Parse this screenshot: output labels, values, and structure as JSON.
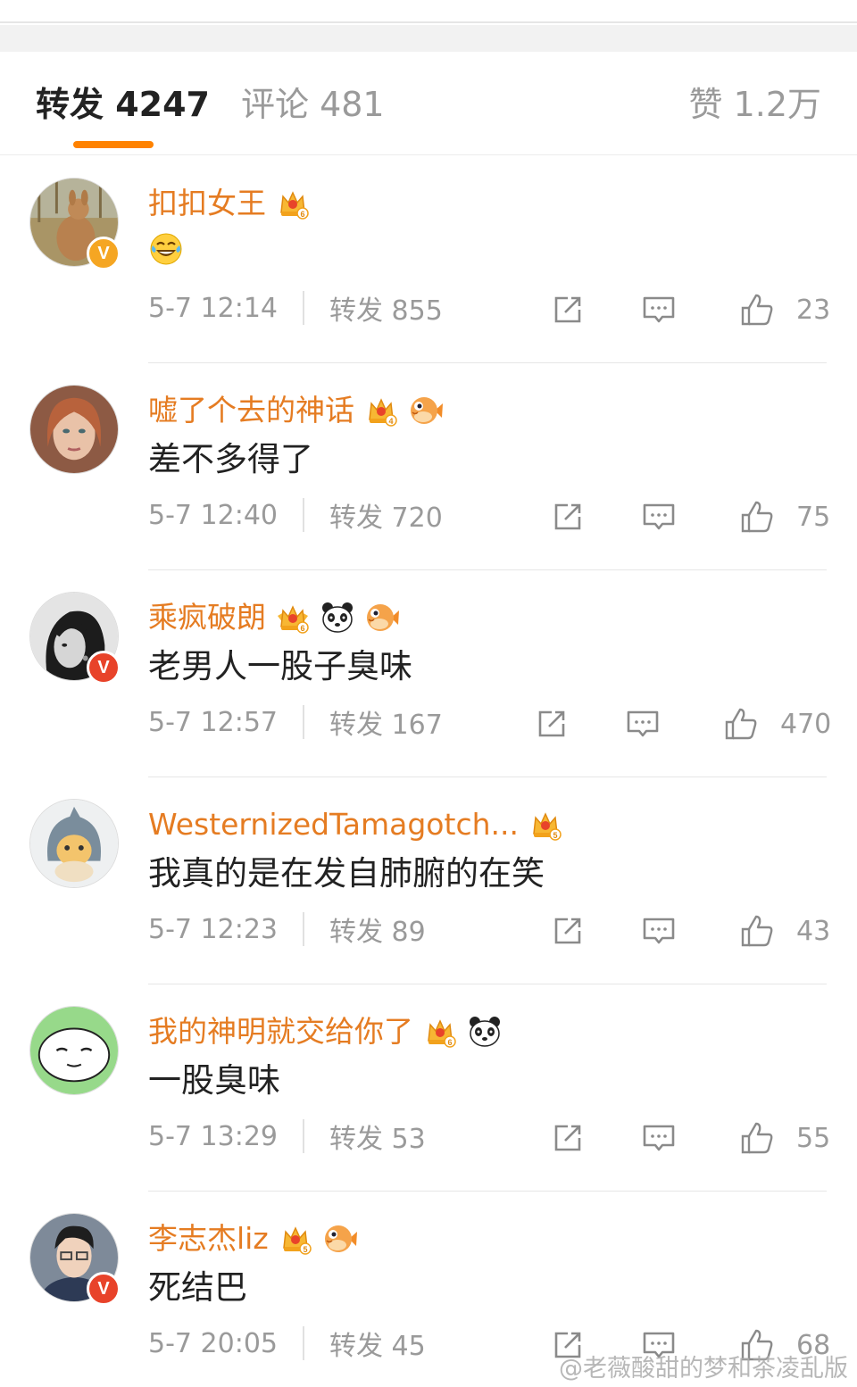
{
  "tabs": {
    "repost": "转发 4247",
    "comment": "评论 481",
    "like": "赞 1.2万"
  },
  "colors": {
    "accent": "#ff8200",
    "username": "#e57c22",
    "muted": "#9a9a9a"
  },
  "reposts": [
    {
      "username": "扣扣女王",
      "avatar": "kangaroo-photo",
      "verified": "gold",
      "badges": [
        "crown-level-6-icon"
      ],
      "content": "",
      "content_emoji": "laughing-tears-emoji",
      "time": "5-7 12:14",
      "repost_count": "转发 855",
      "likes": "23"
    },
    {
      "username": "嘘了个去的神话",
      "avatar": "woman-portrait",
      "verified": "",
      "badges": [
        "crown-level-4-icon",
        "puffer-fish-icon"
      ],
      "content": "差不多得了",
      "time": "5-7 12:40",
      "repost_count": "转发 720",
      "likes": "75"
    },
    {
      "username": "乘疯破朗",
      "avatar": "bw-portrait",
      "verified": "red",
      "badges": [
        "crown-level-6-wings-icon",
        "panda-icon",
        "puffer-fish-icon"
      ],
      "content": "老男人一股子臭味",
      "time": "5-7 12:57",
      "repost_count": "转发 167",
      "likes": "470"
    },
    {
      "username": "WesternizedTamagotch...",
      "avatar": "shark-cat-toy",
      "verified": "",
      "badges": [
        "crown-level-5-icon"
      ],
      "content": "我真的是在发自肺腑的在笑",
      "time": "5-7 12:23",
      "repost_count": "转发 89",
      "likes": "43"
    },
    {
      "username": "我的神明就交给你了",
      "avatar": "meme-face",
      "verified": "",
      "badges": [
        "crown-level-6-icon",
        "panda-icon"
      ],
      "content": "一股臭味",
      "time": "5-7 13:29",
      "repost_count": "转发 53",
      "likes": "55"
    },
    {
      "username": "李志杰liz",
      "avatar": "man-portrait",
      "verified": "red",
      "badges": [
        "crown-level-5-icon",
        "puffer-fish-icon"
      ],
      "content": "死结巴",
      "time": "5-7 20:05",
      "repost_count": "转发 45",
      "likes": "68"
    }
  ],
  "verified_badge_letter": "V",
  "watermark": "@老薇酸甜的梦和茶凌乱版"
}
